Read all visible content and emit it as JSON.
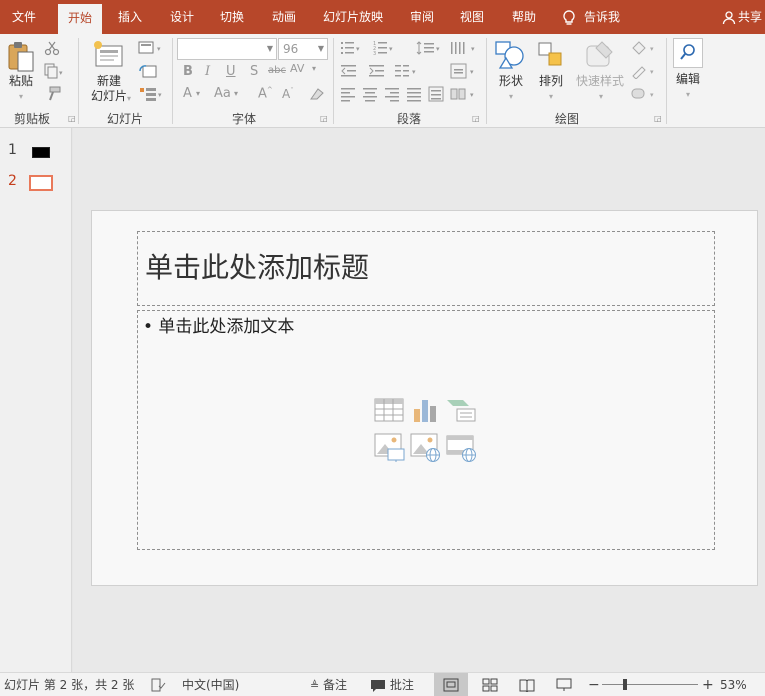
{
  "tabs": {
    "file": "文件",
    "home": "开始",
    "insert": "插入",
    "design": "设计",
    "transitions": "切换",
    "animations": "动画",
    "slideshow": "幻灯片放映",
    "review": "审阅",
    "view": "视图",
    "help": "帮助",
    "tellme": "告诉我",
    "share": "共享"
  },
  "ribbon": {
    "clipboard": {
      "label": "剪贴板",
      "paste": "粘贴"
    },
    "slides": {
      "label": "幻灯片",
      "new_slide_line1": "新建",
      "new_slide_line2": "幻灯片"
    },
    "font": {
      "label": "字体",
      "font_name": "",
      "font_size": "96"
    },
    "paragraph": {
      "label": "段落"
    },
    "drawing": {
      "label": "绘图",
      "shapes": "形状",
      "arrange": "排列",
      "quick_styles": "快速样式"
    },
    "editing": {
      "label": "编辑"
    }
  },
  "thumbnails": [
    {
      "number": "1"
    },
    {
      "number": "2"
    }
  ],
  "slide": {
    "title_placeholder": "单击此处添加标题",
    "body_placeholder": "• 单击此处添加文本"
  },
  "status": {
    "slide_info": "幻灯片 第 2 张，共 2 张",
    "language": "中文(中国)",
    "notes": "备注",
    "comments": "批注",
    "zoom": "53%",
    "zoom_level": 0.53
  },
  "colors": {
    "accent": "#b7472a",
    "selected_thumb_border": "#e9795a"
  }
}
